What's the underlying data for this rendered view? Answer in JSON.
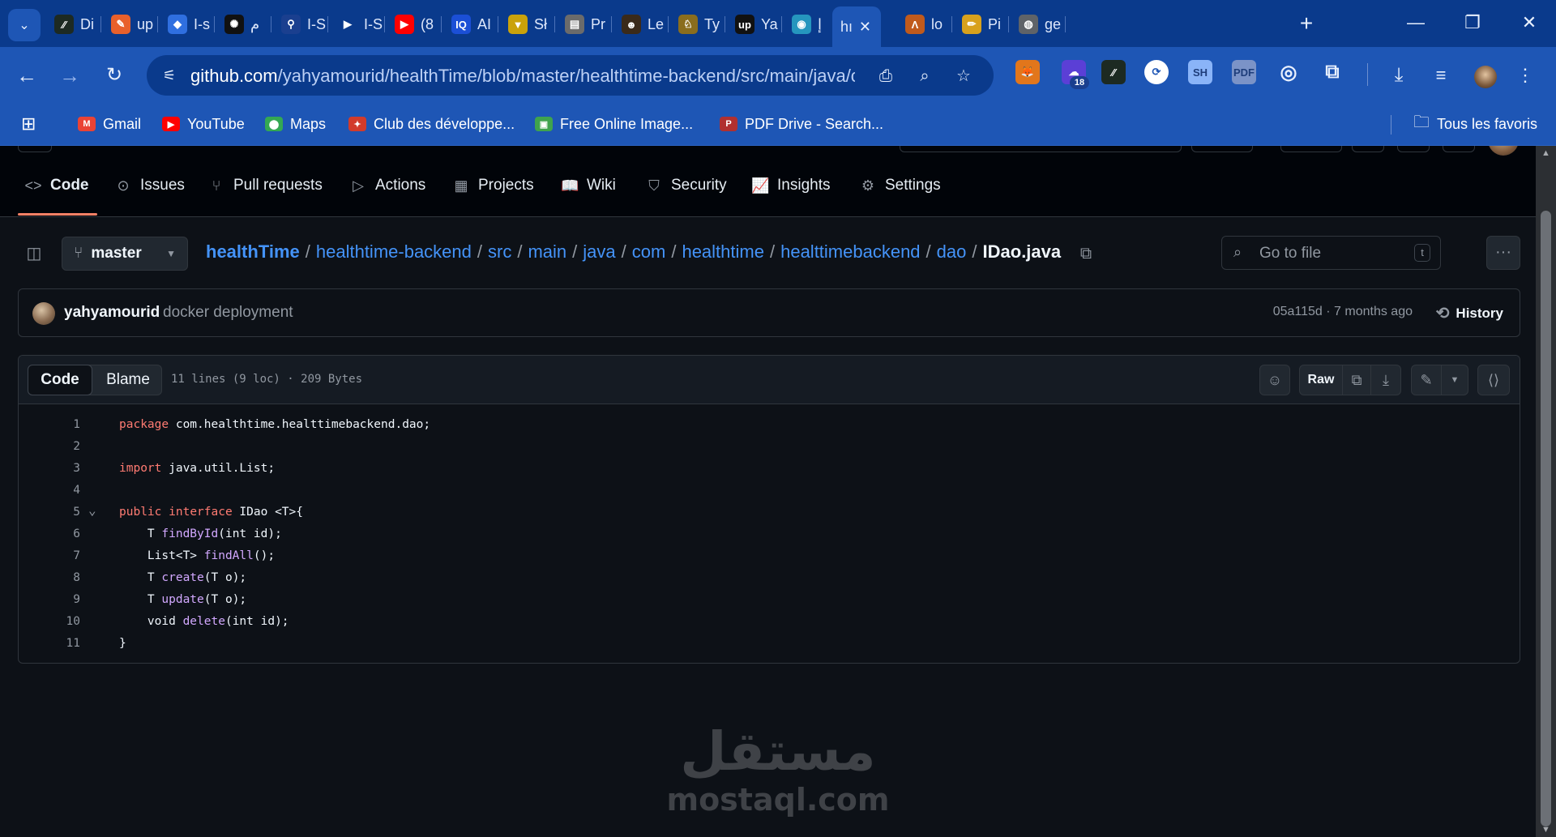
{
  "browser": {
    "tabs": [
      {
        "label": "Di",
        "icon": "slash-logo",
        "color": "#1d2a22",
        "glyph": "⁄⁄"
      },
      {
        "label": "up",
        "icon": "orange-pen",
        "color": "#e8602b",
        "glyph": "✎"
      },
      {
        "label": "I-s",
        "icon": "jira-logo",
        "color": "#2f6fe0",
        "glyph": "◆"
      },
      {
        "label": "م",
        "icon": "openai-logo",
        "color": "#111111",
        "glyph": "✺"
      },
      {
        "label": "I-S",
        "icon": "blue-key",
        "color": "#1a3f8f",
        "glyph": "⚲"
      },
      {
        "label": "I-S",
        "icon": "play-arrow",
        "color": "#0a3a8c",
        "glyph": "▶"
      },
      {
        "label": "(8",
        "icon": "youtube-logo",
        "color": "#ff0000",
        "glyph": "▶"
      },
      {
        "label": "AI",
        "icon": "iq-logo",
        "color": "#1b4fd6",
        "glyph": "IQ"
      },
      {
        "label": "Sł",
        "icon": "yellow-triangle",
        "color": "#caa20a",
        "glyph": "▼"
      },
      {
        "label": "Pr",
        "icon": "document-icon",
        "color": "#6b6b6b",
        "glyph": "▤"
      },
      {
        "label": "Le",
        "icon": "face-icon",
        "color": "#3a2a1a",
        "glyph": "☻"
      },
      {
        "label": "Ty",
        "icon": "lion-icon",
        "color": "#8a6d1d",
        "glyph": "♘"
      },
      {
        "label": "Ya",
        "icon": "upwork-logo",
        "color": "#111111",
        "glyph": "up"
      },
      {
        "label": "إ",
        "icon": "ring-icon",
        "color": "#2596be",
        "glyph": "◉"
      },
      {
        "label": "hı",
        "icon": "",
        "color": "#1e56b5",
        "glyph": ""
      },
      {
        "label": "lo",
        "icon": "orange-a-logo",
        "color": "#c05a1c",
        "glyph": "Λ"
      },
      {
        "label": "Pi",
        "icon": "pencil-icon",
        "color": "#d8a11d",
        "glyph": "✏"
      },
      {
        "label": "ge",
        "icon": "globe-icon",
        "color": "#5f6368",
        "glyph": "◍"
      }
    ],
    "active_tab_close": "✕",
    "new_tab": "+",
    "window_controls": {
      "minimize": "—",
      "restore": "❐",
      "close": "✕"
    },
    "url_host": "github.com",
    "url_path": "/yahyamourid/healthTime/blob/master/healthtime-backend/src/main/java/c...",
    "extensions": [
      {
        "name": "metamask-icon",
        "color": "#e2761b",
        "glyph": "🦊"
      },
      {
        "name": "badge-extension-icon",
        "color": "#5b3fd6",
        "glyph": "☁",
        "badge": "18"
      },
      {
        "name": "slash-extension-icon",
        "color": "#1d2a22",
        "glyph": "⁄⁄"
      },
      {
        "name": "sync-extension-icon",
        "color": "#ffffff",
        "glyph": "⟳"
      },
      {
        "name": "sh-extension-icon",
        "color": "#8ab4f8",
        "glyph": "SH"
      },
      {
        "name": "pdf-extension-icon",
        "color": "#7b93c7",
        "glyph": "PDF"
      },
      {
        "name": "target-extension-icon",
        "color": "#1e56b5",
        "glyph": "◎"
      },
      {
        "name": "puzzle-extensions-icon",
        "color": "#1e56b5",
        "glyph": "⧉"
      }
    ],
    "bookmarks": [
      {
        "label": "Gmail",
        "icon": "gmail-icon",
        "color": "#ea4335",
        "glyph": "M"
      },
      {
        "label": "YouTube",
        "icon": "youtube-icon",
        "color": "#ff0000",
        "glyph": "▶"
      },
      {
        "label": "Maps",
        "icon": "maps-icon",
        "color": "#34a853",
        "glyph": "⬤"
      },
      {
        "label": "Club des développe...",
        "icon": "dev-club-icon",
        "color": "#d23b2b",
        "glyph": "✦"
      },
      {
        "label": "Free Online Image...",
        "icon": "image-icon",
        "color": "#3fa34d",
        "glyph": "▣"
      },
      {
        "label": "PDF Drive - Search...",
        "icon": "pdf-drive-icon",
        "color": "#b03030",
        "glyph": "P"
      }
    ],
    "all_bookmarks": "Tous les favoris"
  },
  "repo_nav": {
    "items": [
      {
        "label": "Code",
        "icon": "code-icon",
        "glyph": "<>"
      },
      {
        "label": "Issues",
        "icon": "issue-icon",
        "glyph": "⊙"
      },
      {
        "label": "Pull requests",
        "icon": "pull-request-icon",
        "glyph": "⑂"
      },
      {
        "label": "Actions",
        "icon": "play-circle-icon",
        "glyph": "▷"
      },
      {
        "label": "Projects",
        "icon": "table-icon",
        "glyph": "▦"
      },
      {
        "label": "Wiki",
        "icon": "book-icon",
        "glyph": "📖"
      },
      {
        "label": "Security",
        "icon": "shield-icon",
        "glyph": "⛉"
      },
      {
        "label": "Insights",
        "icon": "graph-icon",
        "glyph": "📈"
      },
      {
        "label": "Settings",
        "icon": "gear-icon",
        "glyph": "⚙"
      }
    ]
  },
  "file_header": {
    "branch": "master",
    "breadcrumb": [
      "healthTime",
      "healthtime-backend",
      "src",
      "main",
      "java",
      "com",
      "healthtime",
      "healttimebackend",
      "dao"
    ],
    "file_name": "IDao.java",
    "goto_placeholder": "Go to file",
    "goto_shortcut": "t"
  },
  "commit": {
    "author": "yahyamourid",
    "message": "docker deployment",
    "meta": "05a115d · 7 months ago",
    "history_label": "History"
  },
  "viewer": {
    "tab_code": "Code",
    "tab_blame": "Blame",
    "stats": "11 lines (9 loc) · 209 Bytes",
    "raw_label": "Raw"
  },
  "code_lines": [
    {
      "n": "1",
      "tokens": [
        [
          "kw",
          "package"
        ],
        [
          "",
          " com.healthtime.healttimebackend.dao;"
        ]
      ]
    },
    {
      "n": "2",
      "tokens": []
    },
    {
      "n": "3",
      "tokens": [
        [
          "kw",
          "import"
        ],
        [
          "",
          " java.util.List;"
        ]
      ]
    },
    {
      "n": "4",
      "tokens": []
    },
    {
      "n": "5",
      "fold": true,
      "tokens": [
        [
          "kw",
          "public"
        ],
        [
          "",
          " "
        ],
        [
          "kw",
          "interface"
        ],
        [
          "",
          " IDao <T>{"
        ]
      ]
    },
    {
      "n": "6",
      "tokens": [
        [
          "",
          "    T "
        ],
        [
          "fn",
          "findById"
        ],
        [
          "",
          "(int id);"
        ]
      ]
    },
    {
      "n": "7",
      "tokens": [
        [
          "",
          "    List<T> "
        ],
        [
          "fn",
          "findAll"
        ],
        [
          "",
          "();"
        ]
      ]
    },
    {
      "n": "8",
      "tokens": [
        [
          "",
          "    T "
        ],
        [
          "fn",
          "create"
        ],
        [
          "",
          "(T o);"
        ]
      ]
    },
    {
      "n": "9",
      "tokens": [
        [
          "",
          "    T "
        ],
        [
          "fn",
          "update"
        ],
        [
          "",
          "(T o);"
        ]
      ]
    },
    {
      "n": "10",
      "tokens": [
        [
          "",
          "    void "
        ],
        [
          "fn",
          "delete"
        ],
        [
          "",
          "(int id);"
        ]
      ]
    },
    {
      "n": "11",
      "tokens": [
        [
          "",
          "}"
        ]
      ]
    }
  ],
  "watermark": {
    "arabic": "مستقل",
    "latin": "mostaql.com"
  }
}
